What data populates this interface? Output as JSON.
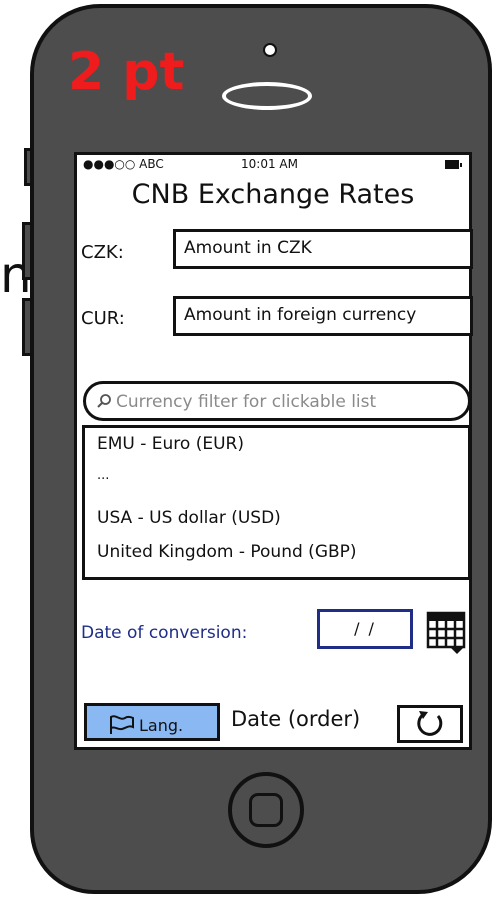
{
  "badge": "2 pt",
  "edge_glyph": "n",
  "status_bar": {
    "carrier": "●●●○○ ABC",
    "time": "10:01 AM"
  },
  "app": {
    "title": "CNB Exchange Rates"
  },
  "czk": {
    "label": "CZK:",
    "placeholder": "Amount in CZK"
  },
  "cur": {
    "label": "CUR:",
    "placeholder": "Amount in foreign currency"
  },
  "filter": {
    "placeholder": "Currency filter for clickable list"
  },
  "currency_list": {
    "items": [
      "EMU - Euro (EUR)",
      "...",
      "USA - US dollar (USD)",
      "United Kingdom - Pound (GBP)"
    ]
  },
  "date": {
    "label": "Date of conversion:",
    "value": "/ /"
  },
  "bottom": {
    "lang_label": "Lang.",
    "order_label": "Date (order)"
  },
  "colors": {
    "badge": "#ee1c1c",
    "accent_blue": "#1f2d87",
    "lang_button": "#8ab8f2",
    "phone_body": "#4d4d4d"
  }
}
